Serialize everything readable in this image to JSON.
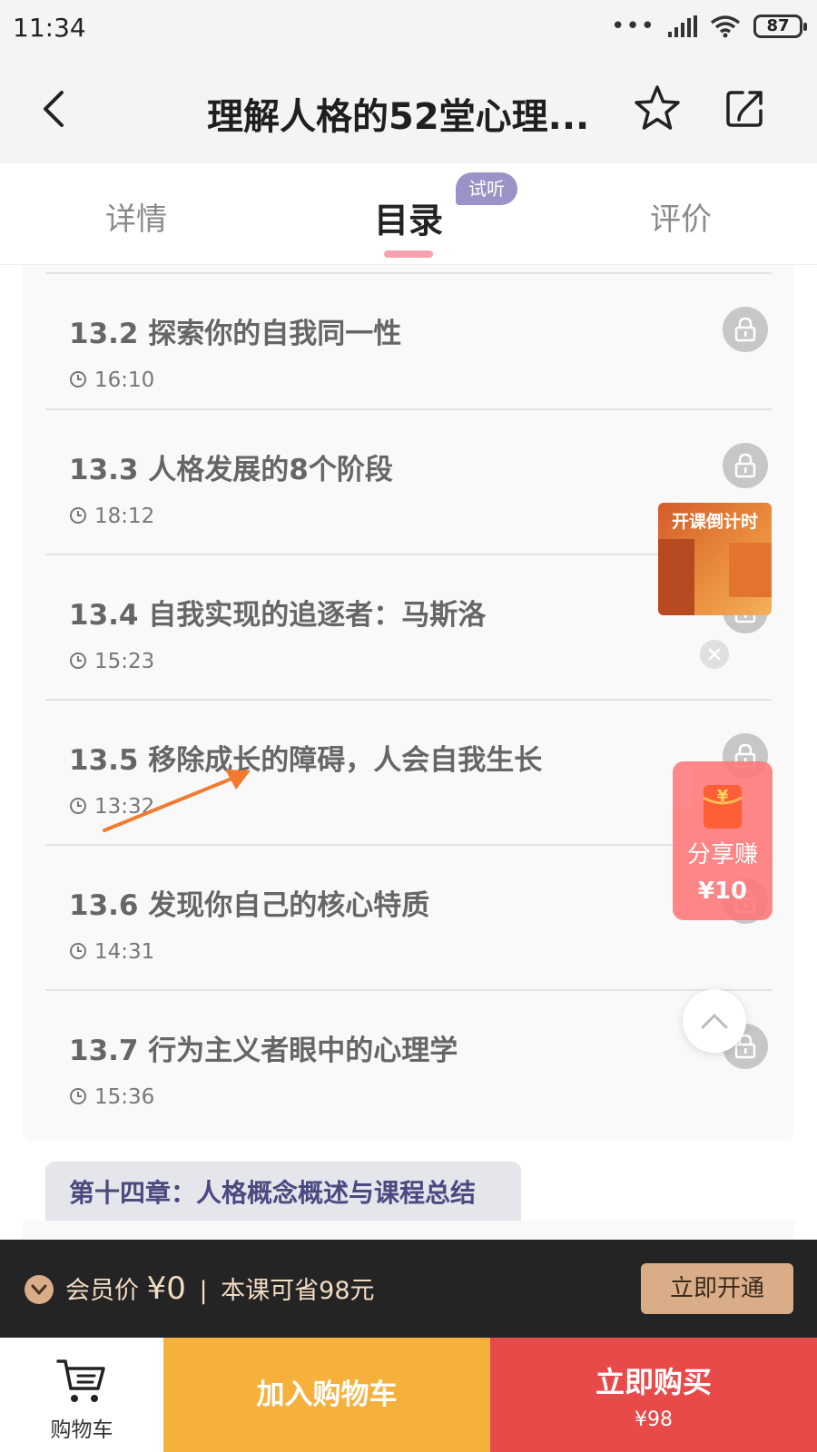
{
  "status_bar": {
    "time": "11:34",
    "dots": "•••",
    "battery": "87"
  },
  "nav": {
    "title": "理解人格的52堂心理..."
  },
  "tabs": [
    {
      "label": "详情"
    },
    {
      "label": "目录",
      "badge": "试听"
    },
    {
      "label": "评价"
    }
  ],
  "lessons": [
    {
      "title": "13.2 探索你的自我同一性",
      "duration": "16:10"
    },
    {
      "title": "13.3 人格发展的8个阶段",
      "duration": "18:12"
    },
    {
      "title": "13.4 自我实现的追逐者：马斯洛",
      "duration": "15:23"
    },
    {
      "title": "13.5 移除成长的障碍，人会自我生长",
      "duration": "13:32"
    },
    {
      "title": "13.6 发现你自己的核心特质",
      "duration": "14:31"
    },
    {
      "title": "13.7 行为主义者眼中的心理学",
      "duration": "15:36"
    }
  ],
  "chapter": {
    "title": "第十四章：人格概念概述与课程总结"
  },
  "countdown": {
    "label": "开课倒计时"
  },
  "share_earn": {
    "label": "分享赚",
    "amount": "¥10"
  },
  "member": {
    "label": "会员价",
    "price": "¥0",
    "savings": "本课可省98元",
    "button": "立即开通"
  },
  "bottom": {
    "cart_label": "购物车",
    "add_cart": "加入购物车",
    "buy_now": "立即购买",
    "buy_price": "¥98"
  },
  "colors": {
    "tab_underline": "#f4a3ae",
    "add_cart_bg": "#f6b13d",
    "buy_now_bg": "#e84a4a",
    "member_bar_bg": "#242424",
    "member_button_bg": "#d9ad88"
  }
}
